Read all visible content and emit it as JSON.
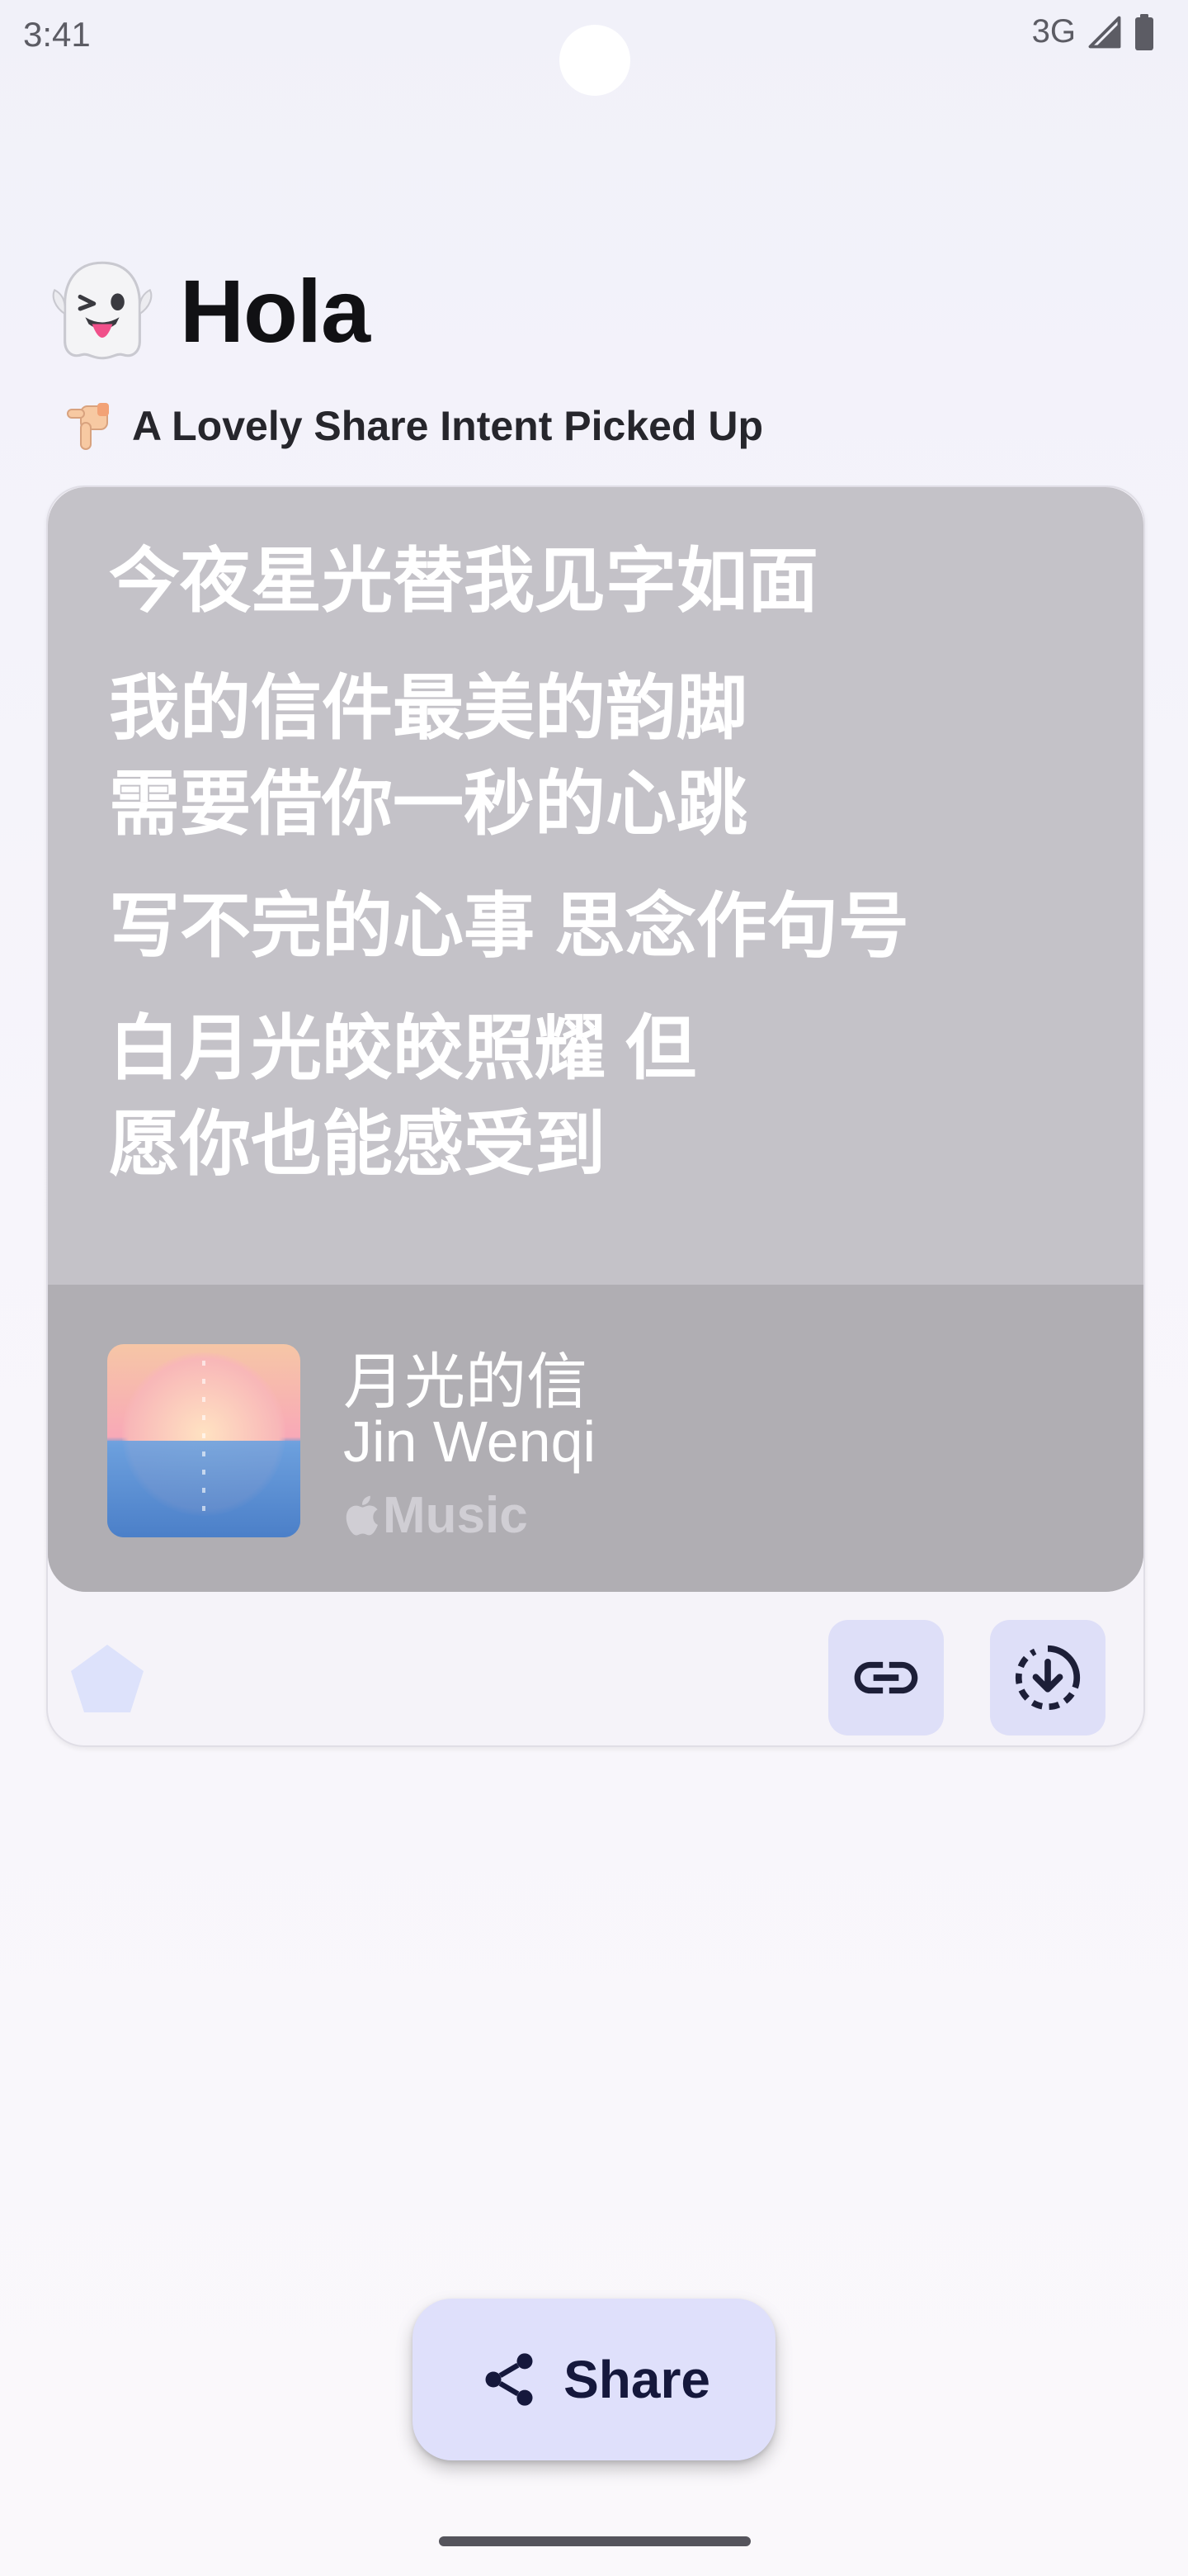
{
  "status_bar": {
    "time": "3:41",
    "network": "3G",
    "icons": [
      "signal-icon",
      "battery-icon"
    ]
  },
  "header": {
    "title": "Hola",
    "title_icon": "ghost-emoji-icon",
    "subtitle": "A Lovely Share Intent Picked Up",
    "subtitle_icon": "pointing-down-hand-icon"
  },
  "card": {
    "lyrics": [
      "今夜星光替我见字如面",
      "我的信件最美的韵脚",
      "需要借你一秒的心跳",
      "写不完的心事 思念作句号",
      "白月光皎皎照耀 但",
      "愿你也能感受到"
    ],
    "song": {
      "title": "月光的信",
      "artist": "Jin Wenqi",
      "service": "Music",
      "service_icon": "apple-icon"
    },
    "actions": [
      {
        "icon": "link-icon"
      },
      {
        "icon": "download-circle-icon"
      }
    ],
    "corner_icon": "pentagon-icon"
  },
  "fab": {
    "label": "Share",
    "icon": "share-icon"
  },
  "colors": {
    "preview_background": "#c4c2c8",
    "song_bar_background": "#b0aeb3",
    "action_button": "#dedff8",
    "fab_background": "#dfe0fb",
    "fab_text": "#15183c",
    "pentagon": "#dde2fb"
  }
}
